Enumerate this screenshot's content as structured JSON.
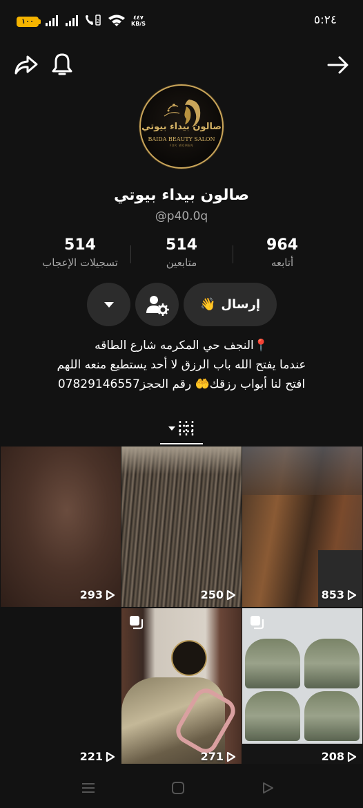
{
  "status_bar": {
    "battery": "١٠٠",
    "net_speed_value": "٤٤٧",
    "net_speed_unit": "KB/S",
    "time": "٥:٢٤"
  },
  "header": {
    "share_icon": "share-icon",
    "bell_icon": "bell-icon",
    "back_icon": "arrow-right-icon"
  },
  "profile": {
    "logo_text": "صالون بيداء بيوتي",
    "logo_subtitle": "BAIDA BEAUTY SALON",
    "logo_tagline": "FOR WOMEN",
    "name": "صالون بيداء بيوتي",
    "handle": "@p40.0q"
  },
  "stats": [
    {
      "value": "964",
      "label": "أتابعه"
    },
    {
      "value": "514",
      "label": "متابعين"
    },
    {
      "value": "514",
      "label": "تسجيلات الإعجاب"
    }
  ],
  "actions": {
    "send_label": "إرسال",
    "send_emoji": "👋"
  },
  "bio": {
    "line1": "📍النجف حي المكرمه شارع الطاقه",
    "line2": "عندما يفتح الله باب الرزق لا أحد يستطيع منعه اللهم",
    "line3": "افتح لنا أبواب رزقك🤲 رقم الحجز07829146557"
  },
  "grid": [
    {
      "views": "853",
      "multi": false
    },
    {
      "views": "250",
      "multi": false
    },
    {
      "views": "293",
      "multi": false
    },
    {
      "views": "208",
      "multi": true
    },
    {
      "views": "271",
      "multi": true
    },
    {
      "views": "221",
      "multi": false
    }
  ],
  "colors": {
    "background": "#121212",
    "button": "#2c2c2c",
    "muted_text": "#a9a9a9",
    "gold": "#c9a55a"
  }
}
